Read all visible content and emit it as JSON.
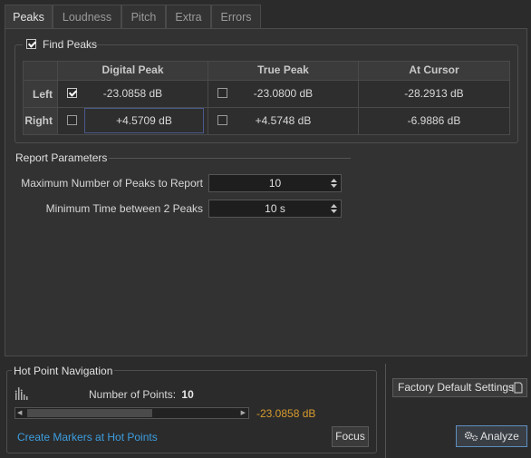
{
  "tabs": [
    {
      "label": "Peaks",
      "active": true
    },
    {
      "label": "Loudness",
      "active": false
    },
    {
      "label": "Pitch",
      "active": false
    },
    {
      "label": "Extra",
      "active": false
    },
    {
      "label": "Errors",
      "active": false
    }
  ],
  "find_peaks": {
    "label": "Find Peaks",
    "checked": true,
    "columns": [
      "Digital Peak",
      "True Peak",
      "At Cursor"
    ],
    "rows": [
      {
        "label": "Left",
        "digital_checked": true,
        "digital": "-23.0858 dB",
        "true_checked": false,
        "true_peak": "-23.0800 dB",
        "at_cursor": "-28.2913 dB"
      },
      {
        "label": "Right",
        "digital_checked": false,
        "digital": "+4.5709 dB",
        "true_checked": false,
        "true_peak": "+4.5748 dB",
        "at_cursor": "-6.9886 dB"
      }
    ]
  },
  "report": {
    "title": "Report Parameters",
    "max_peaks_label": "Maximum Number of Peaks to Report",
    "max_peaks_value": "10",
    "min_time_label": "Minimum Time between 2 Peaks",
    "min_time_value": "10 s"
  },
  "hot_point": {
    "title": "Hot Point Navigation",
    "number_of_points_label": "Number of Points:",
    "number_of_points_value": "10",
    "current_value": "-23.0858 dB",
    "create_markers_link": "Create Markers at Hot Points",
    "focus_button": "Focus"
  },
  "buttons": {
    "factory_default": "Factory Default Settings",
    "analyze": "Analyze"
  },
  "colors": {
    "accent_link": "#3d9ee0",
    "value_orange": "#d79b2e",
    "analyze_border": "#5d8fc0"
  }
}
